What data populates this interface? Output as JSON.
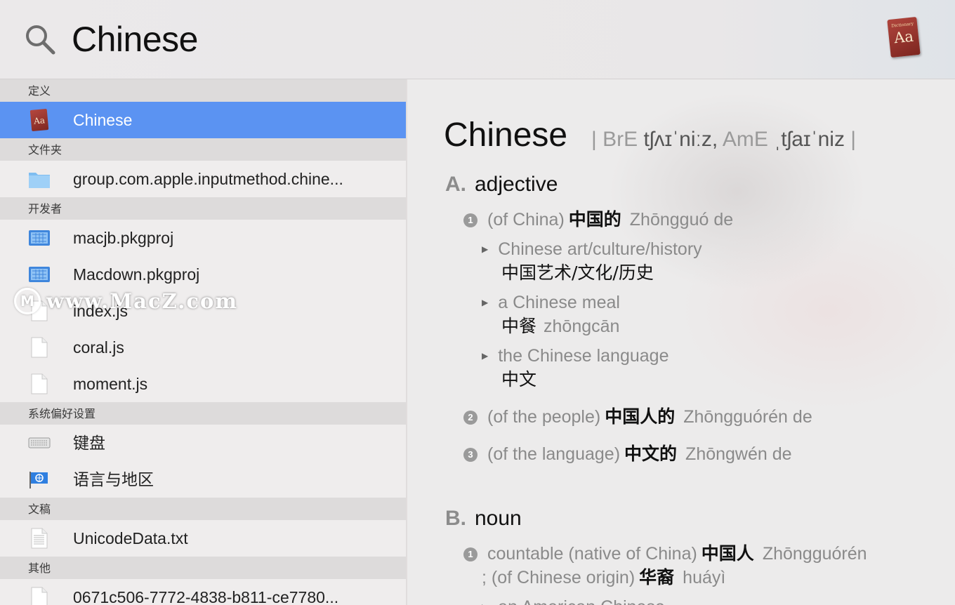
{
  "search": {
    "query": "Chinese"
  },
  "app_icon": {
    "name": "dictionary-icon",
    "top_text": "Dictionary",
    "label": "Aa"
  },
  "colors": {
    "selection": "#5b93f2",
    "section_bg": "#dddbdb"
  },
  "results": {
    "sections": [
      {
        "title": "定义",
        "items": [
          {
            "label": "Chinese",
            "icon": "dictionary-icon",
            "selected": true
          }
        ]
      },
      {
        "title": "文件夹",
        "items": [
          {
            "label": "group.com.apple.inputmethod.chine...",
            "icon": "folder-icon"
          }
        ]
      },
      {
        "title": "开发者",
        "items": [
          {
            "label": "macjb.pkgproj",
            "icon": "xcode-project-icon"
          },
          {
            "label": "Macdown.pkgproj",
            "icon": "xcode-project-icon"
          },
          {
            "label": "index.js",
            "icon": "document-icon"
          },
          {
            "label": "coral.js",
            "icon": "document-icon"
          },
          {
            "label": "moment.js",
            "icon": "document-icon"
          }
        ]
      },
      {
        "title": "系统偏好设置",
        "items": [
          {
            "label": "键盘",
            "icon": "keyboard-icon"
          },
          {
            "label": "语言与地区",
            "icon": "flag-globe-icon"
          }
        ]
      },
      {
        "title": "文稿",
        "items": [
          {
            "label": "UnicodeData.txt",
            "icon": "text-document-icon"
          }
        ]
      },
      {
        "title": "其他",
        "items": [
          {
            "label": "0671c506-7772-4838-b811-ce7780...",
            "icon": "document-icon"
          }
        ]
      }
    ]
  },
  "entry": {
    "headword": "Chinese",
    "pron_sep1": "|",
    "pron_bre_label": "BrE",
    "pron_bre": "tʃʌɪˈniːz,",
    "pron_ame_label": "AmE",
    "pron_ame": "ˌtʃaɪˈniz",
    "pron_sep2": "|",
    "a": {
      "letter": "A.",
      "pos": "adjective",
      "s1": {
        "num": "1",
        "gloss": "(of China)",
        "zh": "中国的",
        "py": "Zhōngguó de"
      },
      "ex1": {
        "en": "Chinese art/culture/history",
        "zh": "中国艺术/文化/历史"
      },
      "ex2": {
        "en": "a Chinese meal",
        "zh": "中餐",
        "py": "zhōngcān"
      },
      "ex3": {
        "en": "the Chinese language",
        "zh": "中文"
      },
      "s2": {
        "num": "2",
        "gloss": "(of the people)",
        "zh": "中国人的",
        "py": "Zhōngguórén de"
      },
      "s3": {
        "num": "3",
        "gloss": "(of the language)",
        "zh": "中文的",
        "py": "Zhōngwén de"
      }
    },
    "b": {
      "letter": "B.",
      "pos": "noun",
      "s1": {
        "num": "1",
        "gloss": "countable (native of China)",
        "zh": "中国人",
        "py": "Zhōngguórén"
      },
      "s1_cont": {
        "gloss": "; (of Chinese origin)",
        "zh": "华裔",
        "py": "huáyì"
      },
      "ex1": {
        "en": "an American Chinese"
      }
    }
  },
  "watermark": {
    "text": "www.MacZ.com",
    "icon_letter": "M"
  }
}
